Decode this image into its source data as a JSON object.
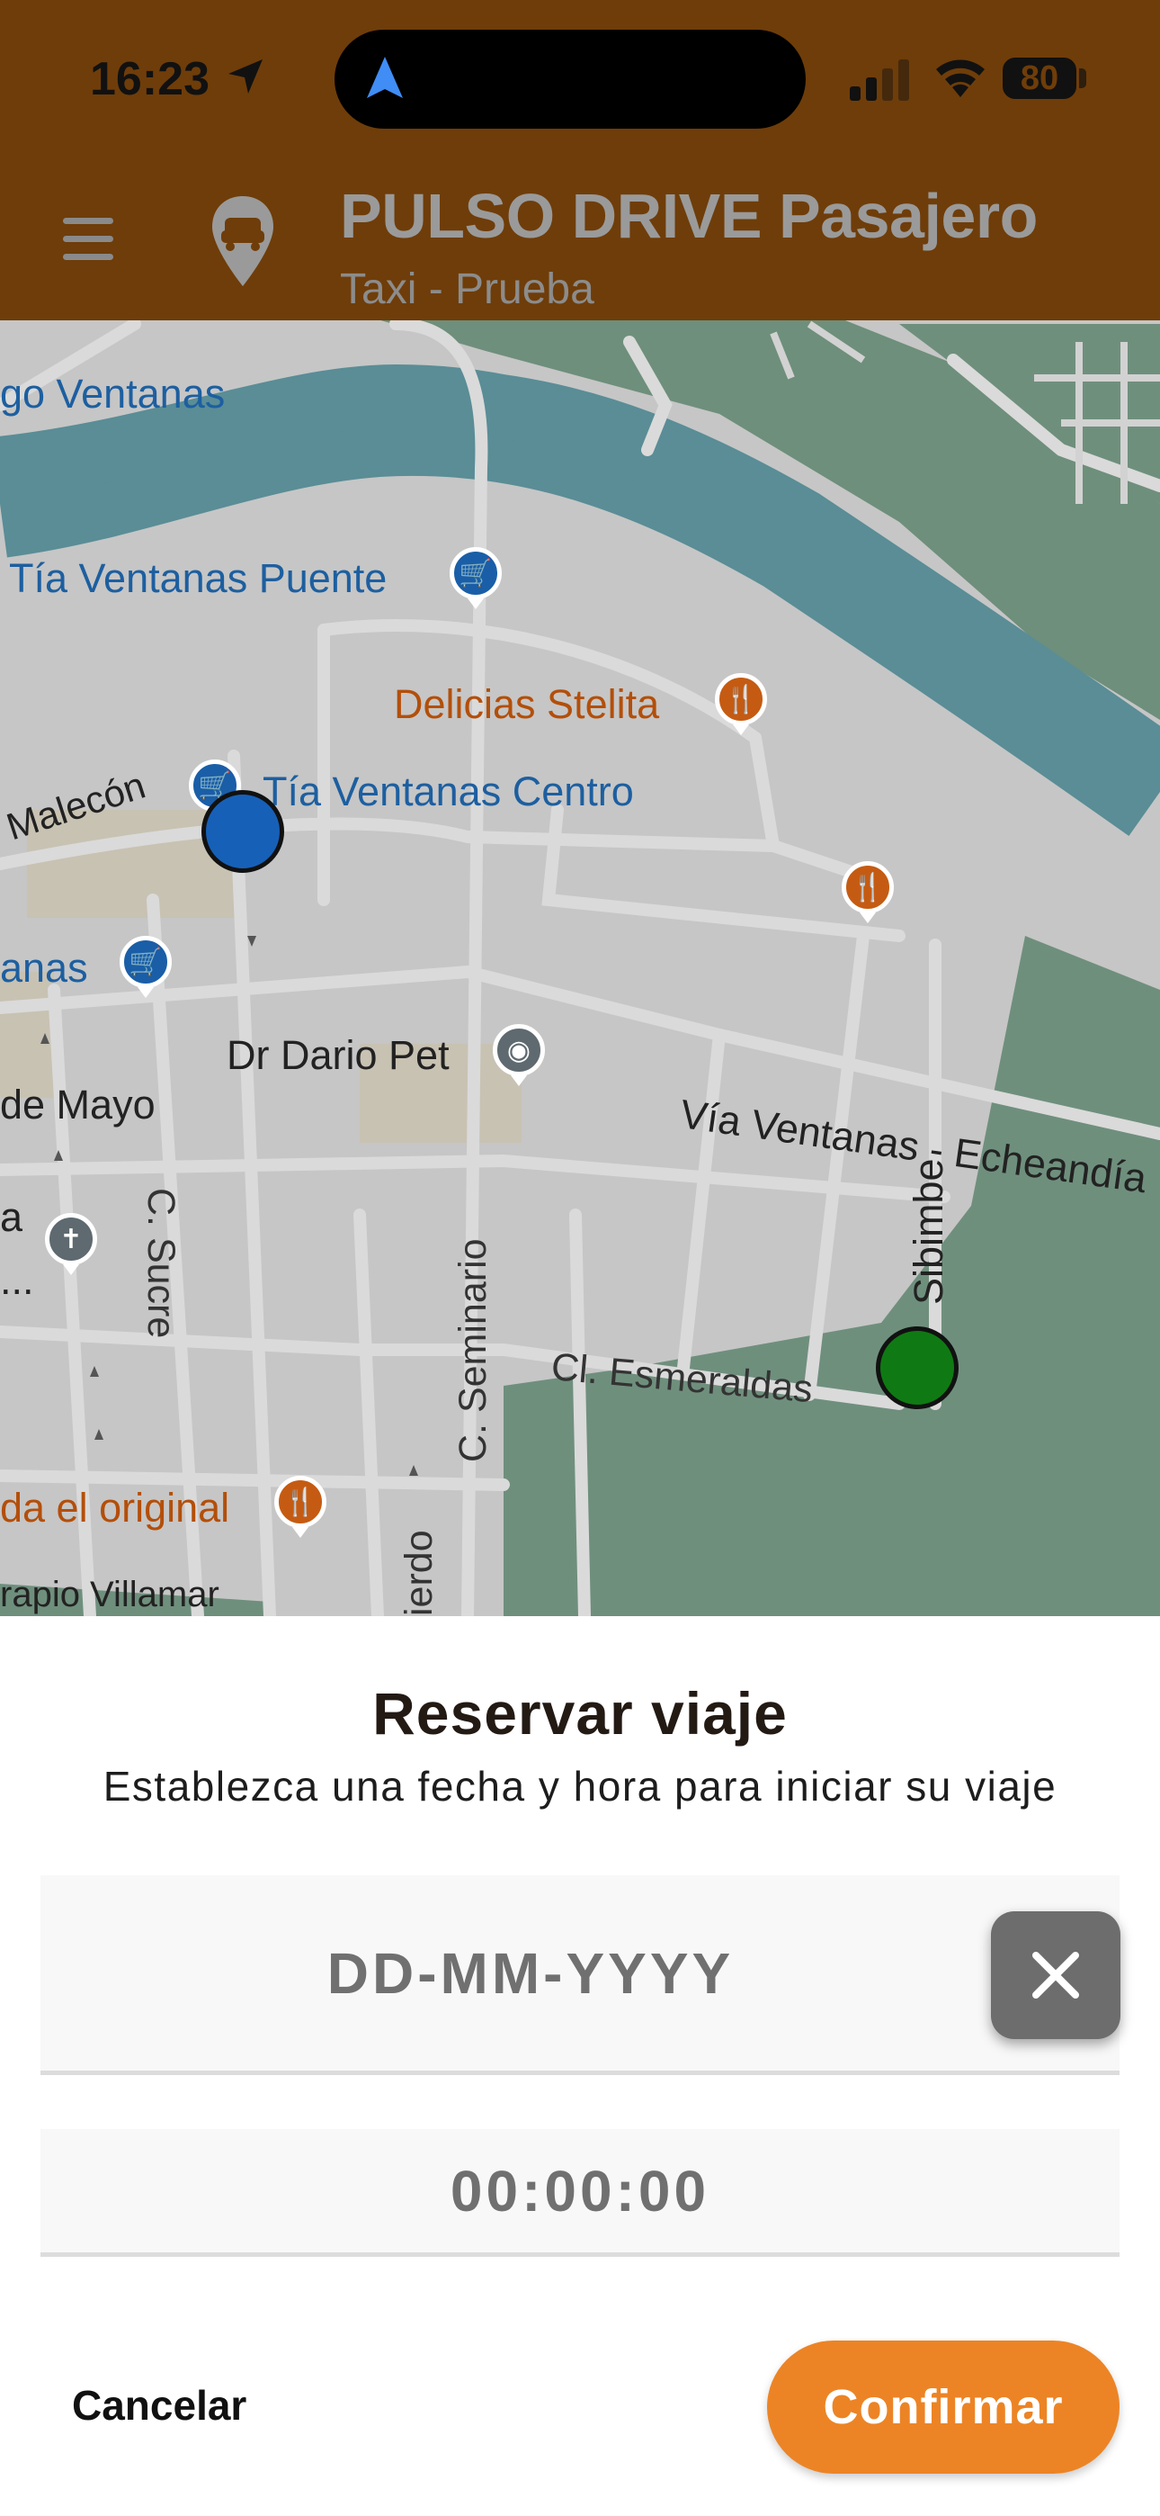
{
  "status_bar": {
    "time": "16:23",
    "battery": "80"
  },
  "header": {
    "title": "PULSO DRIVE Pasajero",
    "subtitle": "Taxi - Prueba"
  },
  "map": {
    "labels": {
      "ventanas_top": "go Ventanas",
      "tia_puente": "Tía Ventanas Puente",
      "delicias": "Delicias Stelita",
      "malecon": "Malecón",
      "tia_centro": "Tía Ventanas Centro",
      "anas": "anas",
      "dr_dario": "Dr Dario Pet",
      "via_ventanas": "Vía Ventanas - Echeandía",
      "de_mayo": "de Mayo",
      "sibimbe": "Sibimbe",
      "a": "a",
      "dots": "...",
      "c_sucre": "C. Sucre",
      "c_seminario": "C. Seminario",
      "cl_esmeraldas": "Cl. Esmeraldas",
      "da_original": "da el original",
      "rapio_villamar": "rapio Villamar",
      "ierdo": "ierdo"
    },
    "colors": {
      "land": "#c5c5c5",
      "river": "#5a8d96",
      "green": "#6f8f7d",
      "origin_marker": "#1760b8",
      "destination_marker": "#0f7a13"
    }
  },
  "sheet": {
    "title": "Reservar viaje",
    "subtitle": "Establezca una fecha y hora para iniciar su viaje",
    "date_placeholder": "DD-MM-YYYY",
    "time_placeholder": "00:00:00",
    "cancel_label": "Cancelar",
    "confirm_label": "Confirmar",
    "accent_color": "#ec8425"
  }
}
